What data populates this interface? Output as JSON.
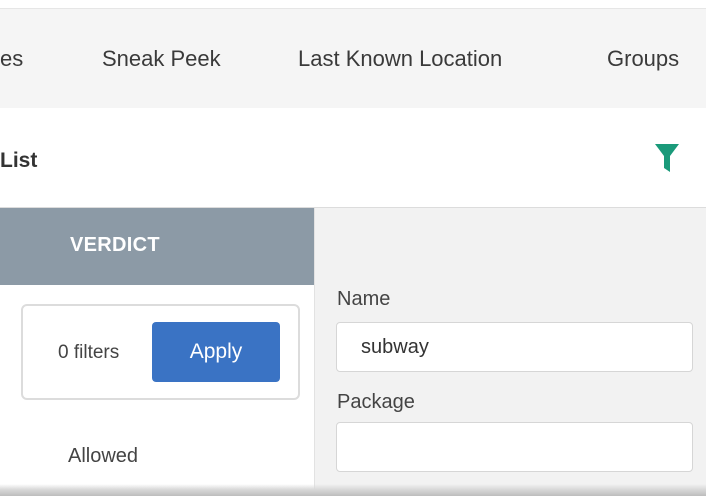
{
  "tabs": [
    {
      "label": "es"
    },
    {
      "label": "Sneak Peek"
    },
    {
      "label": "Last Known Location"
    },
    {
      "label": "Groups"
    }
  ],
  "section": {
    "title": "List",
    "filter_icon": "filter-funnel-icon",
    "filter_icon_color": "#1a9a7a"
  },
  "left_panel": {
    "column_header": "VERDICT",
    "column_header_bg": "#8c9aa6",
    "filters_count": "0 filters",
    "apply_label": "Apply",
    "apply_color": "#3a73c4",
    "items": [
      {
        "label": "Allowed"
      }
    ]
  },
  "right_panel": {
    "name_label": "Name",
    "name_value": "subway",
    "package_label": "Package",
    "package_value": ""
  }
}
